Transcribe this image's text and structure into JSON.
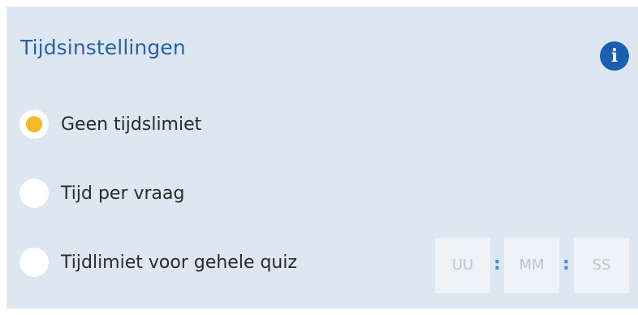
{
  "panel": {
    "title": "Tijdsinstellingen",
    "info_icon_glyph": "i",
    "info_icon": "info-icon"
  },
  "options": [
    {
      "label": "Geen tijdslimiet",
      "selected": true
    },
    {
      "label": "Tijd per vraag",
      "selected": false
    },
    {
      "label": "Tijdlimiet voor gehele quiz",
      "selected": false
    }
  ],
  "time_inputs": {
    "hours_placeholder": "UU",
    "minutes_placeholder": "MM",
    "seconds_placeholder": "SS",
    "separator": ":"
  },
  "colors": {
    "panel_bg": "#dde6f1",
    "title": "#2563a8",
    "info_bg": "#1a5fb0",
    "radio_selected": "#f4b829",
    "separator": "#4a8ad0"
  }
}
